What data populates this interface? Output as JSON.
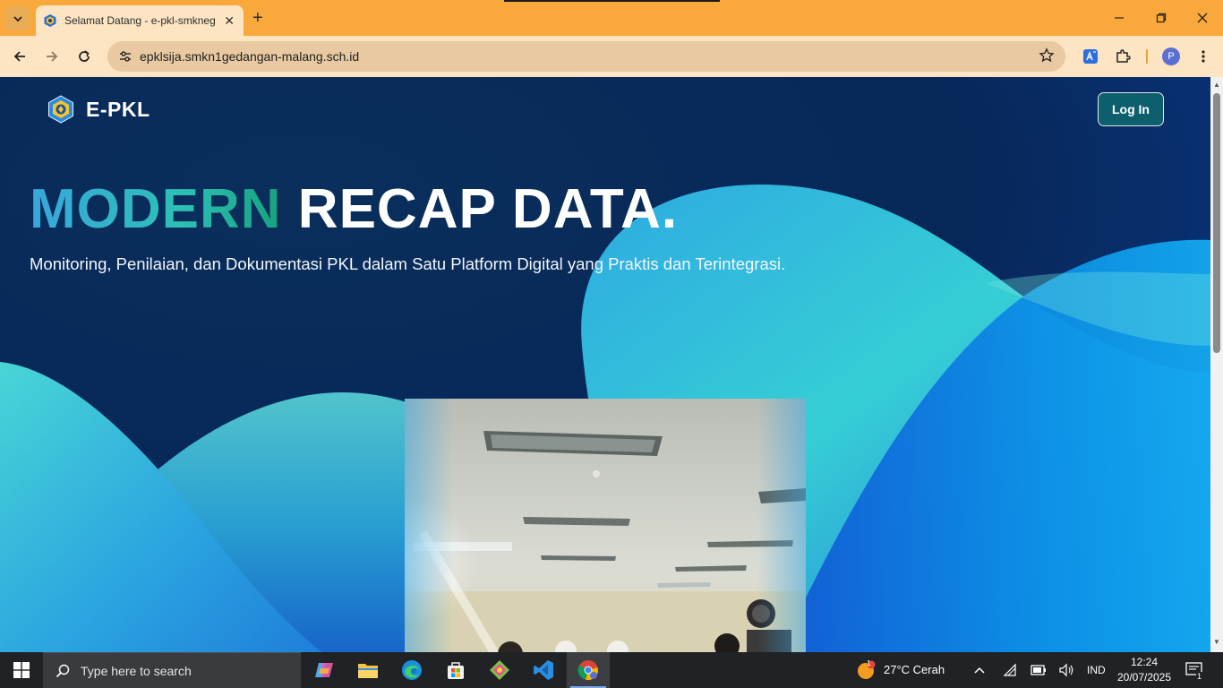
{
  "browser": {
    "tab_title": "Selamat Datang - e-pkl-smkneg",
    "url": "epklsija.smkn1gedangan-malang.sch.id",
    "profile_initial": "P"
  },
  "page": {
    "brand_name": "E-PKL",
    "login_label": "Log In",
    "hero_accent": "MODERN",
    "hero_rest": "RECAP DATA.",
    "hero_subtitle": "Monitoring, Penilaian, dan Dokumentasi PKL dalam Satu Platform Digital yang Praktis dan Terintegrasi."
  },
  "taskbar": {
    "search_placeholder": "Type here to search",
    "weather": "27°C  Cerah",
    "weather_badge": "1",
    "language": "IND",
    "time": "12:24",
    "date": "20/07/2025",
    "notification_count": "1"
  },
  "colors": {
    "titlebar": "#f9a93b",
    "toolbar": "#fde4c3",
    "page_bg": "#072a63",
    "login_button": "#0d5f6e",
    "hero_accent_start": "#39a6dc",
    "hero_accent_end": "#17a17d"
  }
}
